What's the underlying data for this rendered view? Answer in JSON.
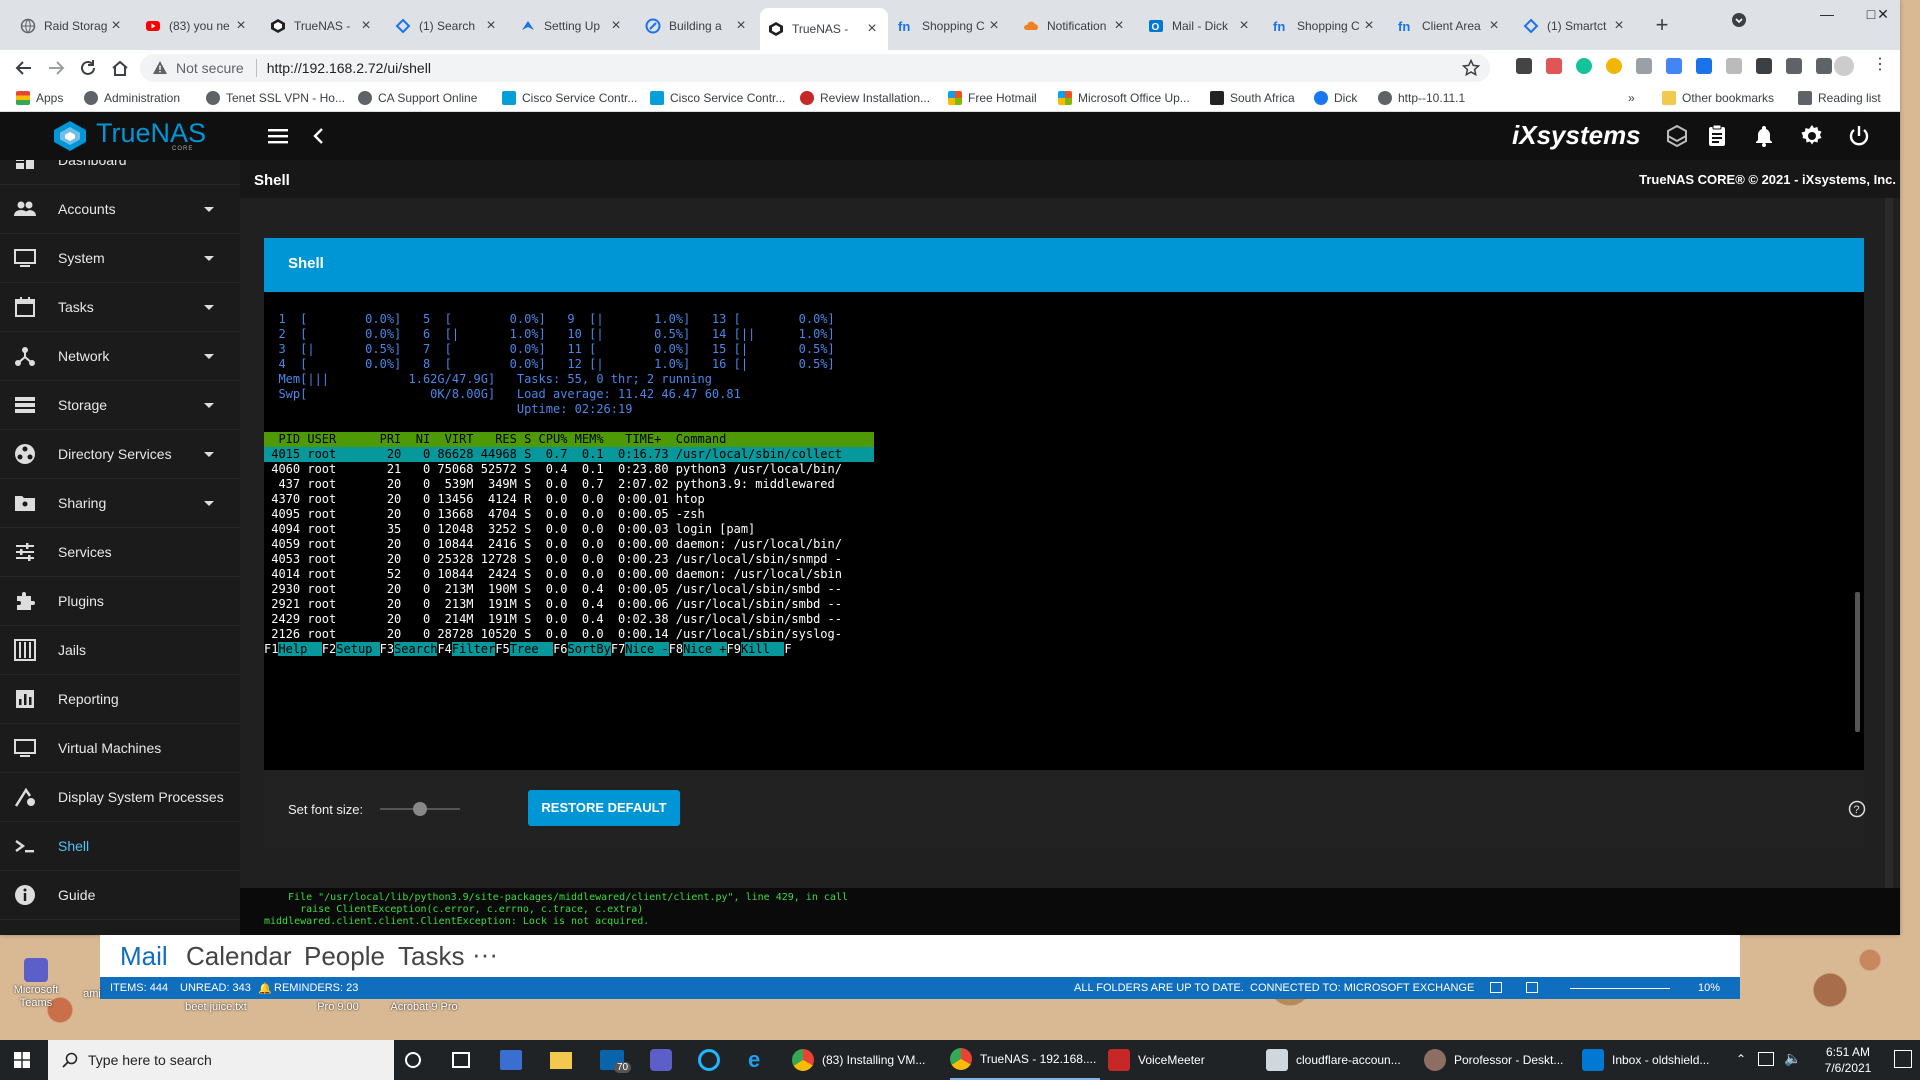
{
  "browser": {
    "tabs": [
      {
        "title": "Raid Storag",
        "favicon": "globe-icon"
      },
      {
        "title": "(83) you ne",
        "favicon": "youtube-icon"
      },
      {
        "title": "TrueNAS -",
        "favicon": "truenas-icon"
      },
      {
        "title": "(1) Search",
        "favicon": "blue-diamond-icon"
      },
      {
        "title": "Setting Up",
        "favicon": "blue-wing-icon"
      },
      {
        "title": "Building a",
        "favicon": "blue-globe-icon"
      },
      {
        "title": "TrueNAS -",
        "favicon": "truenas-icon",
        "active": true
      },
      {
        "title": "Shopping C",
        "favicon": "fn-icon"
      },
      {
        "title": "Notification",
        "favicon": "cloud-icon"
      },
      {
        "title": "Mail - Dick",
        "favicon": "outlook-icon"
      },
      {
        "title": "Shopping C",
        "favicon": "fn-icon"
      },
      {
        "title": "Client Area",
        "favicon": "fn-icon"
      },
      {
        "title": "(1) Smartct",
        "favicon": "blue-diamond-icon"
      }
    ],
    "security_label": "Not secure",
    "url": "http://192.168.2.72/ui/shell",
    "bookmarks": [
      "Apps",
      "Administration",
      "Tenet SSL VPN - Ho...",
      "CA Support Online",
      "Cisco Service Contr...",
      "Cisco Service Contr...",
      "Review Installation...",
      "Free Hotmail",
      "Microsoft Office Up...",
      "South Africa",
      "Dick",
      "http--10.11.1"
    ],
    "bookmarks_overflow": "»",
    "other_bookmarks": "Other bookmarks",
    "reading_list": "Reading list"
  },
  "truenas": {
    "brand": "TrueNAS",
    "brand_sub": "CORE",
    "vendor": "iXsystems",
    "page_title": "Shell",
    "copyright": "TrueNAS CORE® © 2021 - iXsystems, Inc.",
    "sidebar": [
      {
        "label": "Dashboard",
        "icon": "dashboard-icon",
        "expand": false
      },
      {
        "label": "Accounts",
        "icon": "accounts-icon",
        "expand": true
      },
      {
        "label": "System",
        "icon": "system-icon",
        "expand": true
      },
      {
        "label": "Tasks",
        "icon": "calendar-icon",
        "expand": true
      },
      {
        "label": "Network",
        "icon": "network-icon",
        "expand": true
      },
      {
        "label": "Storage",
        "icon": "storage-icon",
        "expand": true
      },
      {
        "label": "Directory Services",
        "icon": "directory-services-icon",
        "expand": true
      },
      {
        "label": "Sharing",
        "icon": "sharing-icon",
        "expand": true
      },
      {
        "label": "Services",
        "icon": "services-icon",
        "expand": false
      },
      {
        "label": "Plugins",
        "icon": "plugins-icon",
        "expand": false
      },
      {
        "label": "Jails",
        "icon": "jails-icon",
        "expand": false
      },
      {
        "label": "Reporting",
        "icon": "reporting-icon",
        "expand": false
      },
      {
        "label": "Virtual Machines",
        "icon": "vm-icon",
        "expand": false
      },
      {
        "label": "Display System Processes",
        "icon": "processes-icon",
        "expand": false
      },
      {
        "label": "Shell",
        "icon": "shell-icon",
        "expand": false,
        "active": true
      },
      {
        "label": "Guide",
        "icon": "guide-icon",
        "expand": false
      }
    ],
    "card_title": "Shell",
    "font_size_label": "Set font size:",
    "font_size_level": 0.5,
    "restore_button": "RESTORE DEFAULT",
    "error_lines": [
      "  File \"/usr/local/lib/python3.9/site-packages/middlewared/client/client.py\", line 429, in call",
      "    raise ClientException(c.error, c.errno, c.trace, c.extra)",
      "middlewared.client.client.ClientException: Lock is not acquired."
    ]
  },
  "terminal": {
    "cpu_lines": [
      "  1  [        0.0%]   5  [        0.0%]   9  [|       1.0%]   13 [        0.0%]",
      "  2  [        0.0%]   6  [|       1.0%]   10 [|       0.5%]   14 [||      1.0%]",
      "  3  [|       0.5%]   7  [        0.0%]   11 [        0.0%]   15 [|       0.5%]",
      "  4  [        0.0%]   8  [        0.0%]   12 [|       1.0%]   16 [|       0.5%]"
    ],
    "mem_line": "  Mem[|||           1.62G/47.9G]   Tasks: 55, 0 thr; 2 running",
    "swp_line": "  Swp[                 0K/8.00G]   Load average: 11.42 46.47 60.81",
    "uptime_line": "                                   Uptime: 02:26:19",
    "header": "  PID USER      PRI  NI  VIRT   RES S CPU% MEM%   TIME+  Command",
    "processes": [
      " 4015 root       20   0 86628 44968 S  0.7  0.1  0:16.73 /usr/local/sbin/collect",
      " 4060 root       21   0 75068 52572 S  0.4  0.1  0:23.80 python3 /usr/local/bin/",
      "  437 root       20   0  539M  349M S  0.0  0.7  2:07.02 python3.9: middlewared",
      " 4370 root       20   0 13456  4124 R  0.0  0.0  0:00.01 htop",
      " 4095 root       20   0 13668  4704 S  0.0  0.0  0:00.05 -zsh",
      " 4094 root       35   0 12048  3252 S  0.0  0.0  0:00.03 login [pam]",
      " 4059 root       20   0 10844  2416 S  0.0  0.0  0:00.00 daemon: /usr/local/bin/",
      " 4053 root       20   0 25328 12728 S  0.0  0.0  0:00.23 /usr/local/sbin/snmpd -",
      " 4014 root       52   0 10844  2424 S  0.0  0.0  0:00.00 daemon: /usr/local/sbin",
      " 2930 root       20   0  213M  190M S  0.0  0.4  0:00.05 /usr/local/sbin/smbd --",
      " 2921 root       20   0  213M  191M S  0.0  0.4  0:00.06 /usr/local/sbin/smbd --",
      " 2429 root       20   0  214M  191M S  0.0  0.4  0:02.38 /usr/local/sbin/smbd --",
      " 2126 root       20   0 28728 10520 S  0.0  0.0  0:00.14 /usr/local/sbin/syslog-"
    ],
    "fkeys": [
      {
        "key": "F1",
        "label": "Help  "
      },
      {
        "key": "F2",
        "label": "Setup "
      },
      {
        "key": "F3",
        "label": "Search"
      },
      {
        "key": "F4",
        "label": "Filter"
      },
      {
        "key": "F5",
        "label": "Tree  "
      },
      {
        "key": "F6",
        "label": "SortBy"
      },
      {
        "key": "F7",
        "label": "Nice -"
      },
      {
        "key": "F8",
        "label": "Nice +"
      },
      {
        "key": "F9",
        "label": "Kill  "
      },
      {
        "key": "F",
        "label": ""
      }
    ]
  },
  "outlook": {
    "nav": [
      "Mail",
      "Calendar",
      "People",
      "Tasks",
      "···"
    ],
    "items": "ITEMS: 444",
    "unread": "UNREAD: 343",
    "reminders": "REMINDERS: 23",
    "sync": "ALL FOLDERS ARE UP TO DATE.",
    "connection": "CONNECTED TO: MICROSOFT EXCHANGE",
    "zoom": "10%"
  },
  "desktop": {
    "labels": [
      "Microsoft Teams",
      "beet juice.txt",
      "Pro 9.00",
      "Acrobat 9 Pro",
      "ami"
    ]
  },
  "taskbar": {
    "search_placeholder": "Type here to search",
    "badge": "70",
    "apps": [
      "(83) Installing VM...",
      "TrueNAS - 192.168....",
      "VoiceMeeter",
      "cloudflare-accoun...",
      "Porofessor - Deskt...",
      "Inbox - oldshield..."
    ],
    "time": "6:51 AM",
    "date": "7/6/2021"
  },
  "colors": {
    "accent": "#0095d5",
    "sidebar_active": "#4fc3f7",
    "terminal_green": "#3dda3d",
    "htop_header": "#4e9a06",
    "htop_selected": "#06989a"
  }
}
